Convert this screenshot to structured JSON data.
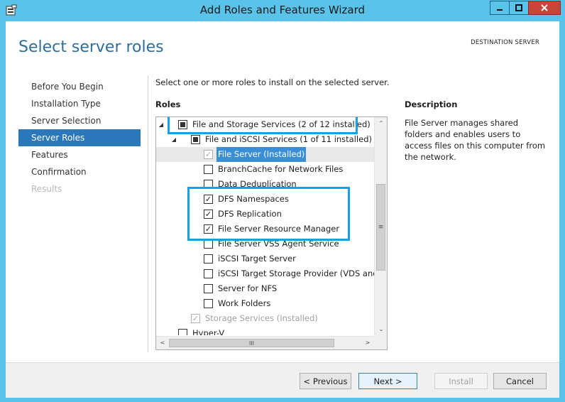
{
  "window": {
    "title": "Add Roles and Features Wizard",
    "minimize_glyph": "▁",
    "maximize_glyph": "□",
    "close_glyph": "✕"
  },
  "header": {
    "page_title": "Select server roles",
    "destination_label": "DESTINATION SERVER"
  },
  "nav": {
    "items": [
      {
        "label": "Before You Begin",
        "state": "normal"
      },
      {
        "label": "Installation Type",
        "state": "normal"
      },
      {
        "label": "Server Selection",
        "state": "normal"
      },
      {
        "label": "Server Roles",
        "state": "active"
      },
      {
        "label": "Features",
        "state": "normal"
      },
      {
        "label": "Confirmation",
        "state": "normal"
      },
      {
        "label": "Results",
        "state": "disabled"
      }
    ]
  },
  "main": {
    "intro": "Select one or more roles to install on the selected server.",
    "roles_heading": "Roles",
    "description_heading": "Description",
    "description_text": "File Server manages shared folders and enables users to access files on this computer from the network."
  },
  "roles_tree": {
    "rows": [
      {
        "label": "File and Storage Services (2 of 12 installed)",
        "check": "partial",
        "expander": "◢"
      },
      {
        "label": "File and iSCSI Services (1 of 11 installed)",
        "check": "partial",
        "expander": "◢"
      },
      {
        "label": "File Server (Installed)",
        "check": "checked-disabled",
        "selected": true
      },
      {
        "label": "BranchCache for Network Files",
        "check": "unchecked"
      },
      {
        "label": "Data Deduplication",
        "check": "unchecked"
      },
      {
        "label": "DFS Namespaces",
        "check": "checked"
      },
      {
        "label": "DFS Replication",
        "check": "checked"
      },
      {
        "label": "File Server Resource Manager",
        "check": "checked"
      },
      {
        "label": "File Server VSS Agent Service",
        "check": "unchecked"
      },
      {
        "label": "iSCSI Target Server",
        "check": "unchecked"
      },
      {
        "label": "iSCSI Target Storage Provider (VDS and VSS",
        "check": "unchecked"
      },
      {
        "label": "Server for NFS",
        "check": "unchecked"
      },
      {
        "label": "Work Folders",
        "check": "unchecked"
      },
      {
        "label": "Storage Services (Installed)",
        "check": "checked-disabled"
      },
      {
        "label": "Hyper-V",
        "check": "unchecked"
      }
    ],
    "check_glyph": "✓",
    "scroll_up_glyph": "⌃",
    "scroll_down_glyph": "⌄",
    "scroll_left_glyph": "<",
    "scroll_right_glyph": ">",
    "vthumb_grip": "≡",
    "hthumb_grip": "III"
  },
  "footer": {
    "previous_label": "< Previous",
    "next_label": "Next >",
    "install_label": "Install",
    "cancel_label": "Cancel"
  },
  "colors": {
    "titlebar": "#5ac3ea",
    "accent": "#2a77b9",
    "title_text": "#2e6f97",
    "highlight_box": "#19a0e0",
    "selected_row": "#3a8ed6"
  }
}
